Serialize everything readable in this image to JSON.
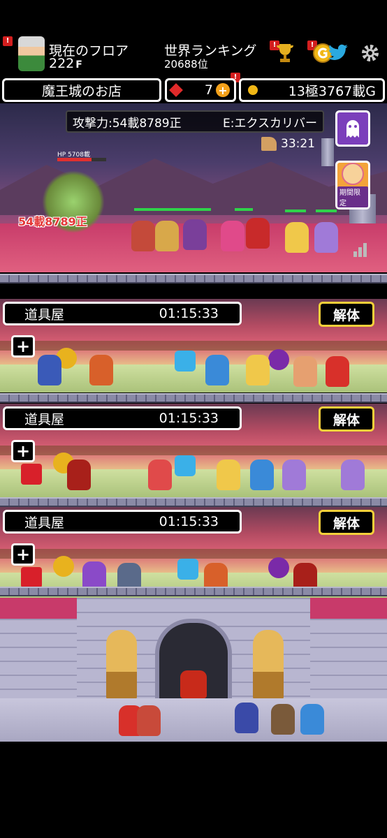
{
  "header": {
    "floor_label": "現在のフロア",
    "floor_value": "222",
    "floor_unit": "F",
    "ranking_label": "世界ランキング",
    "ranking_value": "20688位",
    "shop_name": "魔王城のお店",
    "gems": "7",
    "gold": "13極3767載G",
    "badge": "!",
    "icons": [
      "trophy-icon",
      "gold-g-icon",
      "twitter-bird-icon",
      "gear-icon"
    ]
  },
  "battle": {
    "attack_power": "攻撃力:54載8789正",
    "equipment": "E:エクスカリバー",
    "timer": "33:21",
    "enemy_hp": "HP 5708載",
    "damage": "54載8789正",
    "event_label": "期間限定",
    "enemy_hp_ratio": 0.7
  },
  "shops": [
    {
      "name": "道具屋",
      "timer": "01:15:33",
      "dismantle": "解体",
      "add": "+"
    },
    {
      "name": "道具屋",
      "timer": "01:15:33",
      "dismantle": "解体",
      "add": "+"
    },
    {
      "name": "道具屋",
      "timer": "01:15:33",
      "dismantle": "解体",
      "add": "+"
    }
  ],
  "colors": {
    "accent_gold": "#f5d03a",
    "gem_red": "#e02a2a",
    "coin": "#f1b716",
    "event_purple": "#7b3fbb"
  }
}
